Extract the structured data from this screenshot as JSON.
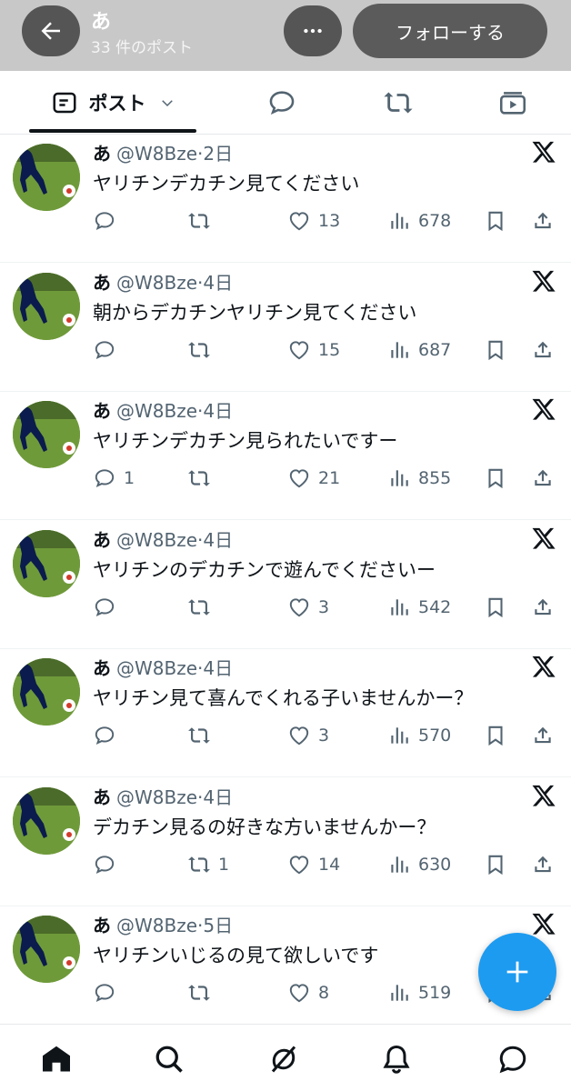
{
  "header": {
    "name": "あ",
    "post_count": "33 件のポスト",
    "follow_label": "フォローする",
    "back_icon": "arrow-left-icon",
    "more_icon": "more-horizontal-icon"
  },
  "tabs": {
    "posts_label": "ポスト",
    "posts_icon": "list-icon",
    "replies_icon": "speech-bubble-icon",
    "reposts_icon": "repost-icon",
    "media_icon": "video-icon"
  },
  "tweets": [
    {
      "name": "あ",
      "handle": "@W8Bze",
      "sep": "·",
      "time": "2日",
      "text": "ヤリチンデカチン見てください",
      "replies": "",
      "reposts": "",
      "likes": "13",
      "views": "678"
    },
    {
      "name": "あ",
      "handle": "@W8Bze",
      "sep": "·",
      "time": "4日",
      "text": "朝からデカチンヤリチン見てください",
      "replies": "",
      "reposts": "",
      "likes": "15",
      "views": "687"
    },
    {
      "name": "あ",
      "handle": "@W8Bze",
      "sep": "·",
      "time": "4日",
      "text": "ヤリチンデカチン見られたいですー",
      "replies": "1",
      "reposts": "",
      "likes": "21",
      "views": "855"
    },
    {
      "name": "あ",
      "handle": "@W8Bze",
      "sep": "·",
      "time": "4日",
      "text": "ヤリチンのデカチンで遊んでくださいー",
      "replies": "",
      "reposts": "",
      "likes": "3",
      "views": "542"
    },
    {
      "name": "あ",
      "handle": "@W8Bze",
      "sep": "·",
      "time": "4日",
      "text": "ヤリチン見て喜んでくれる子いませんかー？",
      "replies": "",
      "reposts": "",
      "likes": "3",
      "views": "570"
    },
    {
      "name": "あ",
      "handle": "@W8Bze",
      "sep": "·",
      "time": "4日",
      "text": "デカチン見るの好きな方いませんかー？",
      "replies": "",
      "reposts": "1",
      "likes": "14",
      "views": "630"
    },
    {
      "name": "あ",
      "handle": "@W8Bze",
      "sep": "·",
      "time": "5日",
      "text": "ヤリチンいじるの見て欲しいです",
      "replies": "",
      "reposts": "",
      "likes": "8",
      "views": "519"
    }
  ],
  "fab_icon": "plus-icon",
  "bottom_nav": [
    "home-icon",
    "search-icon",
    "grok-icon",
    "bell-icon",
    "messages-icon"
  ],
  "colors": {
    "accent": "#1d9bf0",
    "text": "#0f1419",
    "muted": "#536471",
    "header_bg": "#c8c8c8"
  }
}
